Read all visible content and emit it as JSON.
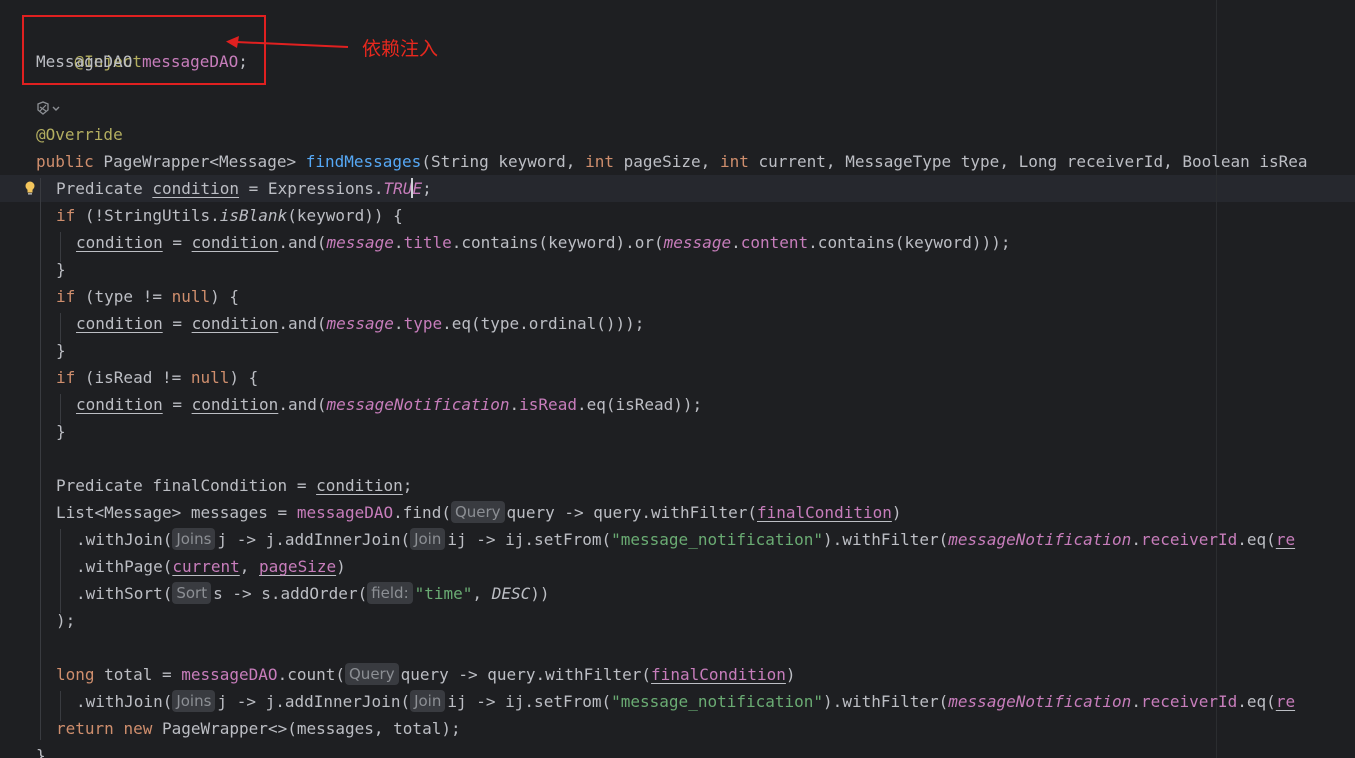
{
  "annotation": {
    "label": "依赖注入"
  },
  "code": {
    "l1": {
      "annotation": "@Inject"
    },
    "l2": {
      "type": "MessageDAO",
      "field": "messageDAO",
      "end": ";"
    },
    "l3": {
      "annotation": "@Override"
    },
    "l4": {
      "kw": "public",
      "t1": " PageWrapper<Message> ",
      "fn": "findMessages",
      "p1": "(String keyword, ",
      "k1": "int",
      "p2": " pageSize, ",
      "k2": "int",
      "p3": " current, MessageType type, Long receiverId, Boolean isRea"
    },
    "l5": {
      "t1": "Predicate ",
      "v": "condition",
      "t2": " = Expressions.",
      "c1": "TRU",
      "c2": "E",
      "t3": ";"
    },
    "l6": {
      "kw": "if",
      "t1": " (!StringUtils.",
      "m": "isBlank",
      "t2": "(keyword)) {"
    },
    "l7": {
      "v1": "condition",
      "t1": " = ",
      "v2": "condition",
      "t2": ".and(",
      "f1": "message",
      "t3": ".",
      "f2": "title",
      "t4": ".contains(keyword).or(",
      "f3": "message",
      "t5": ".",
      "f4": "content",
      "t6": ".contains(keyword)));"
    },
    "l8": {
      "t": "}"
    },
    "l9": {
      "kw": "if",
      "t1": " (type != ",
      "kw2": "null",
      "t2": ") {"
    },
    "l10": {
      "v1": "condition",
      "t1": " = ",
      "v2": "condition",
      "t2": ".and(",
      "f1": "message",
      "t3": ".",
      "f2": "type",
      "t4": ".eq(type.ordinal()));"
    },
    "l11": {
      "t": "}"
    },
    "l12": {
      "kw": "if",
      "t1": " (isRead != ",
      "kw2": "null",
      "t2": ") {"
    },
    "l13": {
      "v1": "condition",
      "t1": " = ",
      "v2": "condition",
      "t2": ".and(",
      "f1": "messageNotification",
      "t3": ".",
      "f2": "isRead",
      "t4": ".eq(isRead));"
    },
    "l14": {
      "t": "}"
    },
    "l15": {
      "t1": "Predicate finalCondition = ",
      "v": "condition",
      "t2": ";"
    },
    "l16": {
      "t1": "List<Message> messages = ",
      "f": "messageDAO",
      "t2": ".find(",
      "h": "Query",
      "t3": "query -> query.withFilter(",
      "v": "finalCondition",
      "t4": ")"
    },
    "l17": {
      "t1": ".withJoin(",
      "h1": "Joins",
      "t2": "j -> j.addInnerJoin(",
      "h2": "Join",
      "t3": "ij -> ij.setFrom(",
      "s": "\"message_notification\"",
      "t4": ").withFilter(",
      "f1": "messageNotification",
      "t5": ".",
      "f2": "receiverId",
      "t6": ".eq(",
      "v": "re"
    },
    "l18": {
      "t1": ".withPage(",
      "v1": "current",
      "t2": ", ",
      "v2": "pageSize",
      "t3": ")"
    },
    "l19": {
      "t1": ".withSort(",
      "h1": "Sort",
      "t2": "s -> s.addOrder(",
      "h2": "field:",
      "s": "\"time\"",
      "t3": ", ",
      "c": "DESC",
      "t4": "))"
    },
    "l20": {
      "t": ");"
    },
    "l21": {
      "kw": "long",
      "t1": " total = ",
      "f": "messageDAO",
      "t2": ".count(",
      "h": "Query",
      "t3": "query -> query.withFilter(",
      "v": "finalCondition",
      "t4": ")"
    },
    "l22": {
      "t1": ".withJoin(",
      "h1": "Joins",
      "t2": "j -> j.addInnerJoin(",
      "h2": "Join",
      "t3": "ij -> ij.setFrom(",
      "s": "\"message_notification\"",
      "t4": ").withFilter(",
      "f1": "messageNotification",
      "t5": ".",
      "f2": "receiverId",
      "t6": ".eq(",
      "v": "re"
    },
    "l23": {
      "kw": "return",
      "t1": " ",
      "kw2": "new",
      "t2": " PageWrapper<>(messages, total);"
    },
    "l24": {
      "t": "}"
    }
  },
  "colors": {
    "annotation_red": "#e02020",
    "background": "#1e1f22"
  },
  "icons": {
    "gutter": "implementations-icon",
    "bulb": "lightbulb-icon"
  }
}
